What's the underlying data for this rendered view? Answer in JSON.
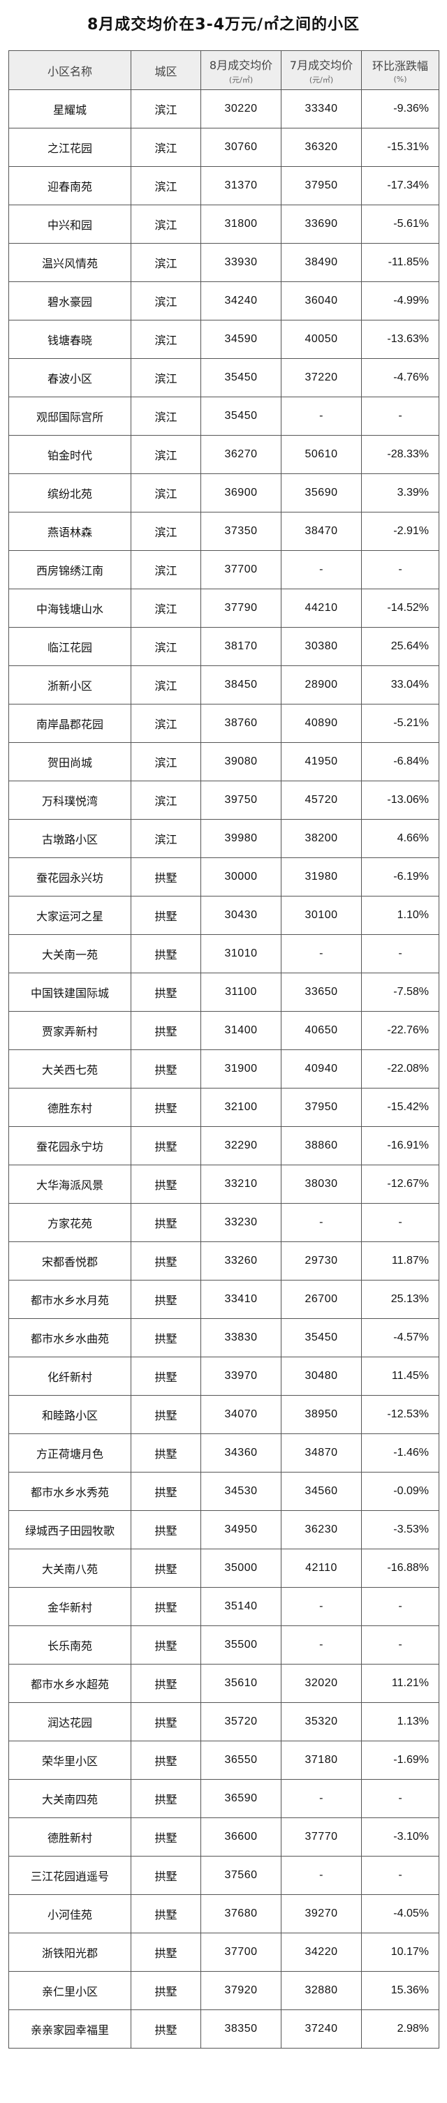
{
  "title": "8月成交均价在3-4万元/㎡之间的小区",
  "headers": {
    "name": "小区名称",
    "district": "城区",
    "aug": "8月成交均价",
    "aug_unit": "(元/㎡)",
    "jul": "7月成交均价",
    "jul_unit": "(元/㎡)",
    "change": "环比涨跌幅",
    "change_unit": "(%)"
  },
  "rows": [
    {
      "name": "星耀城",
      "district": "滨江",
      "aug": "30220",
      "jul": "33340",
      "change": "-9.36%"
    },
    {
      "name": "之江花园",
      "district": "滨江",
      "aug": "30760",
      "jul": "36320",
      "change": "-15.31%"
    },
    {
      "name": "迎春南苑",
      "district": "滨江",
      "aug": "31370",
      "jul": "37950",
      "change": "-17.34%"
    },
    {
      "name": "中兴和园",
      "district": "滨江",
      "aug": "31800",
      "jul": "33690",
      "change": "-5.61%"
    },
    {
      "name": "温兴风情苑",
      "district": "滨江",
      "aug": "33930",
      "jul": "38490",
      "change": "-11.85%"
    },
    {
      "name": "碧水豪园",
      "district": "滨江",
      "aug": "34240",
      "jul": "36040",
      "change": "-4.99%"
    },
    {
      "name": "钱塘春晓",
      "district": "滨江",
      "aug": "34590",
      "jul": "40050",
      "change": "-13.63%"
    },
    {
      "name": "春波小区",
      "district": "滨江",
      "aug": "35450",
      "jul": "37220",
      "change": "-4.76%"
    },
    {
      "name": "观邸国际宫所",
      "district": "滨江",
      "aug": "35450",
      "jul": "-",
      "change": "-"
    },
    {
      "name": "铂金时代",
      "district": "滨江",
      "aug": "36270",
      "jul": "50610",
      "change": "-28.33%"
    },
    {
      "name": "缤纷北苑",
      "district": "滨江",
      "aug": "36900",
      "jul": "35690",
      "change": "3.39%"
    },
    {
      "name": "燕语林森",
      "district": "滨江",
      "aug": "37350",
      "jul": "38470",
      "change": "-2.91%"
    },
    {
      "name": "西房锦绣江南",
      "district": "滨江",
      "aug": "37700",
      "jul": "-",
      "change": "-"
    },
    {
      "name": "中海钱塘山水",
      "district": "滨江",
      "aug": "37790",
      "jul": "44210",
      "change": "-14.52%"
    },
    {
      "name": "临江花园",
      "district": "滨江",
      "aug": "38170",
      "jul": "30380",
      "change": "25.64%"
    },
    {
      "name": "浙新小区",
      "district": "滨江",
      "aug": "38450",
      "jul": "28900",
      "change": "33.04%"
    },
    {
      "name": "南岸晶郡花园",
      "district": "滨江",
      "aug": "38760",
      "jul": "40890",
      "change": "-5.21%"
    },
    {
      "name": "贺田尚城",
      "district": "滨江",
      "aug": "39080",
      "jul": "41950",
      "change": "-6.84%"
    },
    {
      "name": "万科璞悦湾",
      "district": "滨江",
      "aug": "39750",
      "jul": "45720",
      "change": "-13.06%"
    },
    {
      "name": "古墩路小区",
      "district": "滨江",
      "aug": "39980",
      "jul": "38200",
      "change": "4.66%"
    },
    {
      "name": "蚕花园永兴坊",
      "district": "拱墅",
      "aug": "30000",
      "jul": "31980",
      "change": "-6.19%"
    },
    {
      "name": "大家运河之星",
      "district": "拱墅",
      "aug": "30430",
      "jul": "30100",
      "change": "1.10%"
    },
    {
      "name": "大关南一苑",
      "district": "拱墅",
      "aug": "31010",
      "jul": "-",
      "change": "-"
    },
    {
      "name": "中国铁建国际城",
      "district": "拱墅",
      "aug": "31100",
      "jul": "33650",
      "change": "-7.58%"
    },
    {
      "name": "贾家弄新村",
      "district": "拱墅",
      "aug": "31400",
      "jul": "40650",
      "change": "-22.76%"
    },
    {
      "name": "大关西七苑",
      "district": "拱墅",
      "aug": "31900",
      "jul": "40940",
      "change": "-22.08%"
    },
    {
      "name": "德胜东村",
      "district": "拱墅",
      "aug": "32100",
      "jul": "37950",
      "change": "-15.42%"
    },
    {
      "name": "蚕花园永宁坊",
      "district": "拱墅",
      "aug": "32290",
      "jul": "38860",
      "change": "-16.91%"
    },
    {
      "name": "大华海派风景",
      "district": "拱墅",
      "aug": "33210",
      "jul": "38030",
      "change": "-12.67%"
    },
    {
      "name": "方家花苑",
      "district": "拱墅",
      "aug": "33230",
      "jul": "-",
      "change": "-"
    },
    {
      "name": "宋都香悦郡",
      "district": "拱墅",
      "aug": "33260",
      "jul": "29730",
      "change": "11.87%"
    },
    {
      "name": "都市水乡水月苑",
      "district": "拱墅",
      "aug": "33410",
      "jul": "26700",
      "change": "25.13%"
    },
    {
      "name": "都市水乡水曲苑",
      "district": "拱墅",
      "aug": "33830",
      "jul": "35450",
      "change": "-4.57%"
    },
    {
      "name": "化纤新村",
      "district": "拱墅",
      "aug": "33970",
      "jul": "30480",
      "change": "11.45%"
    },
    {
      "name": "和睦路小区",
      "district": "拱墅",
      "aug": "34070",
      "jul": "38950",
      "change": "-12.53%"
    },
    {
      "name": "方正荷塘月色",
      "district": "拱墅",
      "aug": "34360",
      "jul": "34870",
      "change": "-1.46%"
    },
    {
      "name": "都市水乡水秀苑",
      "district": "拱墅",
      "aug": "34530",
      "jul": "34560",
      "change": "-0.09%"
    },
    {
      "name": "绿城西子田园牧歌",
      "district": "拱墅",
      "aug": "34950",
      "jul": "36230",
      "change": "-3.53%"
    },
    {
      "name": "大关南八苑",
      "district": "拱墅",
      "aug": "35000",
      "jul": "42110",
      "change": "-16.88%"
    },
    {
      "name": "金华新村",
      "district": "拱墅",
      "aug": "35140",
      "jul": "-",
      "change": "-"
    },
    {
      "name": "长乐南苑",
      "district": "拱墅",
      "aug": "35500",
      "jul": "-",
      "change": "-"
    },
    {
      "name": "都市水乡水超苑",
      "district": "拱墅",
      "aug": "35610",
      "jul": "32020",
      "change": "11.21%"
    },
    {
      "name": "润达花园",
      "district": "拱墅",
      "aug": "35720",
      "jul": "35320",
      "change": "1.13%"
    },
    {
      "name": "荣华里小区",
      "district": "拱墅",
      "aug": "36550",
      "jul": "37180",
      "change": "-1.69%"
    },
    {
      "name": "大关南四苑",
      "district": "拱墅",
      "aug": "36590",
      "jul": "-",
      "change": "-"
    },
    {
      "name": "德胜新村",
      "district": "拱墅",
      "aug": "36600",
      "jul": "37770",
      "change": "-3.10%"
    },
    {
      "name": "三江花园逍遥号",
      "district": "拱墅",
      "aug": "37560",
      "jul": "-",
      "change": "-"
    },
    {
      "name": "小河佳苑",
      "district": "拱墅",
      "aug": "37680",
      "jul": "39270",
      "change": "-4.05%"
    },
    {
      "name": "浙铁阳光郡",
      "district": "拱墅",
      "aug": "37700",
      "jul": "34220",
      "change": "10.17%"
    },
    {
      "name": "亲仁里小区",
      "district": "拱墅",
      "aug": "37920",
      "jul": "32880",
      "change": "15.36%"
    },
    {
      "name": "亲亲家园幸福里",
      "district": "拱墅",
      "aug": "38350",
      "jul": "37240",
      "change": "2.98%"
    }
  ]
}
